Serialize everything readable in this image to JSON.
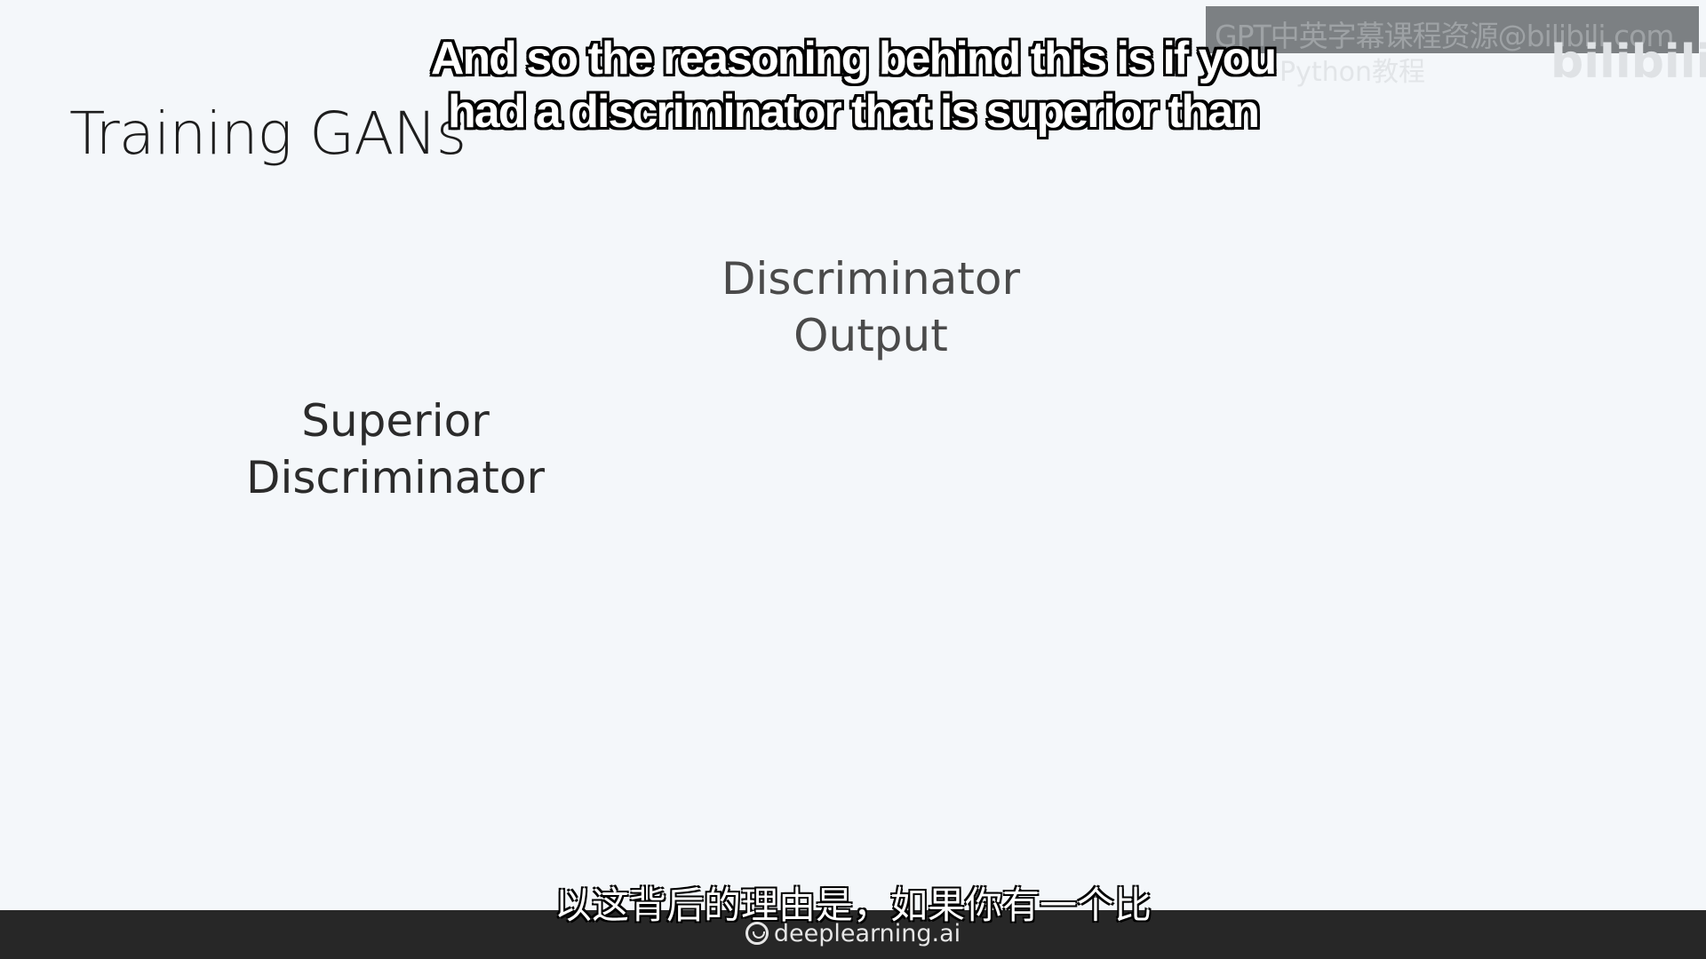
{
  "slide": {
    "title": "Training GANs",
    "output_label": [
      "Discriminator",
      "Output"
    ],
    "superior_label": [
      "Superior",
      "Discriminator"
    ]
  },
  "subtitles": {
    "english": [
      "And so the reasoning behind this is if you",
      "had a discriminator that is superior than"
    ],
    "chinese": "以这背后的理由是，如果你有一个比"
  },
  "footer": {
    "brand": "deeplearning.ai",
    "icon": "deeplearning-logo-icon"
  },
  "watermark": {
    "line1": "GPT中英字幕课程资源@bilibili.com",
    "line2": "Python教程",
    "logo": "bilibili"
  }
}
